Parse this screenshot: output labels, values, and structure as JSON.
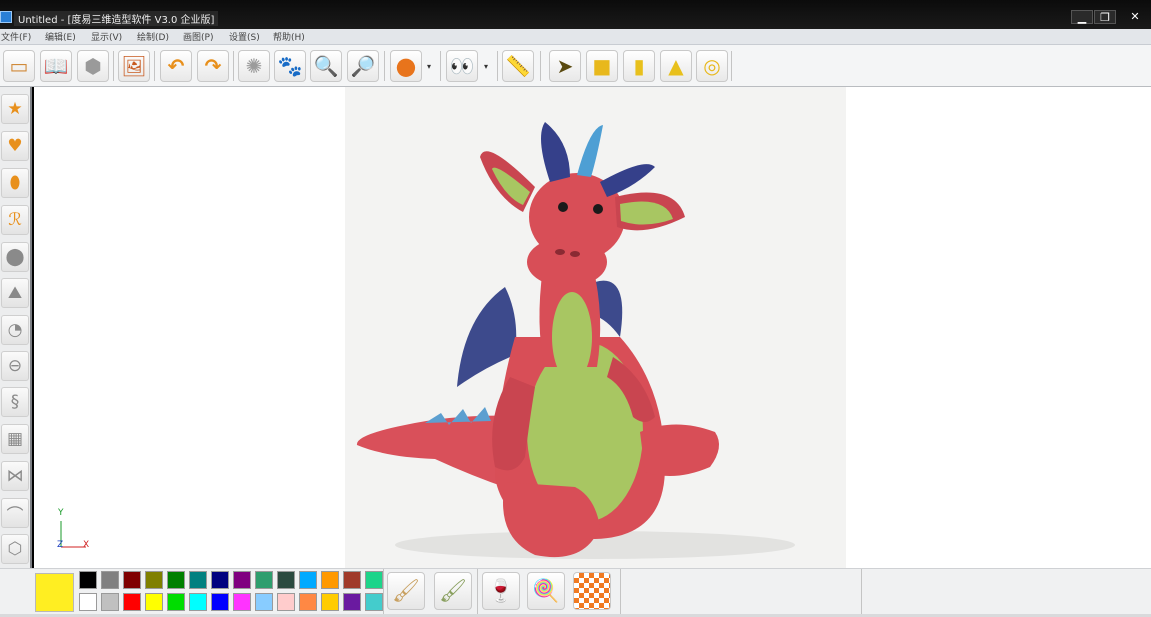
{
  "window": {
    "title": "Untitled - [度易三维造型软件 V3.0 企业版]",
    "minimize": "▁",
    "restore": "❐",
    "close": "✕"
  },
  "menu": [
    "文件(F)",
    "编辑(E)",
    "显示(V)",
    "绘制(D)",
    "画图(P)",
    "设置(S)",
    "帮助(H)"
  ],
  "toolbar": {
    "dropdown_glyph": "▾",
    "buttons": [
      {
        "name": "new-icon",
        "glyph": "▭"
      },
      {
        "name": "open-icon",
        "glyph": "📖"
      },
      {
        "name": "save-icon",
        "glyph": "⬢"
      },
      {
        "name": "print-icon",
        "glyph": "🖼"
      },
      {
        "name": "undo-icon",
        "glyph": "↶"
      },
      {
        "name": "redo-icon",
        "glyph": "↷"
      },
      {
        "name": "rotate-icon",
        "glyph": "✺"
      },
      {
        "name": "pan-icon",
        "glyph": "🐾"
      },
      {
        "name": "zoom-out-icon",
        "glyph": "🔍"
      },
      {
        "name": "zoom-in-icon",
        "glyph": "🔎"
      },
      {
        "name": "material-sphere-icon",
        "glyph": "●"
      },
      {
        "name": "view-eyes-icon",
        "glyph": "👀"
      },
      {
        "name": "ruler-icon",
        "glyph": "📏"
      },
      {
        "name": "select-icon",
        "glyph": "➤"
      },
      {
        "name": "cube-icon",
        "glyph": "■"
      },
      {
        "name": "cylinder-icon",
        "glyph": "▮"
      },
      {
        "name": "cone-icon",
        "glyph": "▲"
      },
      {
        "name": "torus-icon",
        "glyph": "◎"
      }
    ]
  },
  "left_tools": [
    {
      "name": "star-tool-icon",
      "glyph": "★"
    },
    {
      "name": "heart-tool-icon",
      "glyph": "♥"
    },
    {
      "name": "ellipse-tool-icon",
      "glyph": "⬮"
    },
    {
      "name": "curve-tool-icon",
      "glyph": "ℛ"
    },
    {
      "name": "revolve-tool-icon",
      "glyph": "⬤"
    },
    {
      "name": "loft-tool-icon",
      "glyph": "⛰"
    },
    {
      "name": "pie-tool-icon",
      "glyph": "◔"
    },
    {
      "name": "extrude-tool-icon",
      "glyph": "⊖"
    },
    {
      "name": "spring-tool-icon",
      "glyph": "§"
    },
    {
      "name": "grid-tool-icon",
      "glyph": "▦"
    },
    {
      "name": "mirror-tool-icon",
      "glyph": "⋈"
    },
    {
      "name": "sweep-tool-icon",
      "glyph": "⌒"
    },
    {
      "name": "shell-tool-icon",
      "glyph": "⬡"
    }
  ],
  "axis": {
    "y": "Y",
    "z": "Z",
    "x": "X"
  },
  "palette": {
    "current": "#ffee22",
    "top_row": [
      "#000000",
      "#808080",
      "#800000",
      "#808000",
      "#008000",
      "#008080",
      "#000080",
      "#800080",
      "#2e9e6e",
      "#2b4a3f",
      "#00aaff",
      "#ff9900",
      "#a03a2a",
      "#1dd48a"
    ],
    "bottom_row": [
      "#ffffff",
      "#c0c0c0",
      "#ff0000",
      "#ffff00",
      "#00dd00",
      "#00ffff",
      "#0000ff",
      "#ff33ff",
      "#88ccff",
      "#ffcccc",
      "#ff8844",
      "#ffcc00",
      "#6a1aa0",
      "#44cccc"
    ]
  },
  "paint_tools": [
    {
      "name": "brush-icon",
      "glyph": "🖌"
    },
    {
      "name": "smudge-brush-icon",
      "glyph": "🖌"
    },
    {
      "name": "goblet-icon",
      "glyph": "🍷"
    },
    {
      "name": "fill-spoon-icon",
      "glyph": "🍭"
    },
    {
      "name": "checker-texture-icon",
      "glyph": "▦"
    }
  ]
}
